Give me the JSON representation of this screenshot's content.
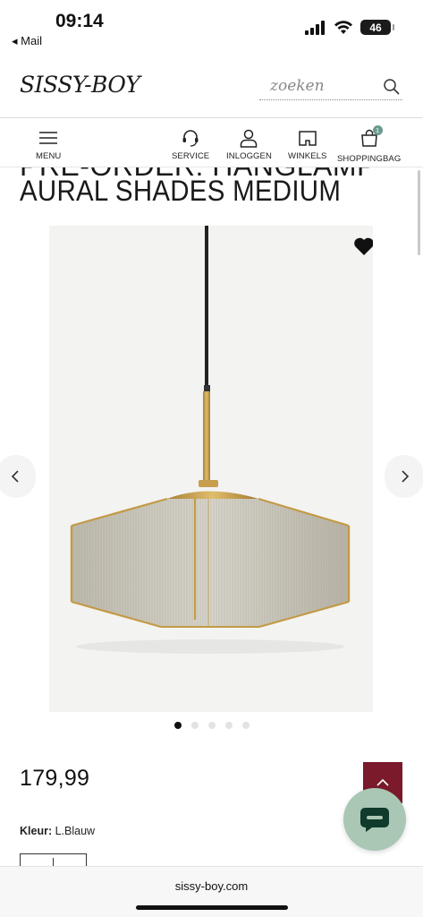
{
  "status_bar": {
    "time": "09:14",
    "back_app": "◂ Mail",
    "battery": "46"
  },
  "header": {
    "logo": "SISSY-BOY",
    "search_placeholder": "zoeken"
  },
  "nav": {
    "menu": "MENU",
    "service": "SERVICE",
    "login": "INLOGGEN",
    "stores": "WINKELS",
    "bag": "SHOPPINGBAG",
    "bag_count": "1"
  },
  "product": {
    "title_partial": "PRE-ORDER: HANGLAMP",
    "title": "AURAL SHADES MEDIUM",
    "price": "179,99",
    "color_label": "Kleur:",
    "color_value": "L.Blauw",
    "gallery_slides": 5,
    "gallery_active_slide": 1
  },
  "browser": {
    "url": "sissy-boy.com"
  },
  "colors": {
    "accent_burgundy": "#7a1a2a",
    "chat_green": "#a9c7b4",
    "bag_badge": "#6a9a8f"
  }
}
